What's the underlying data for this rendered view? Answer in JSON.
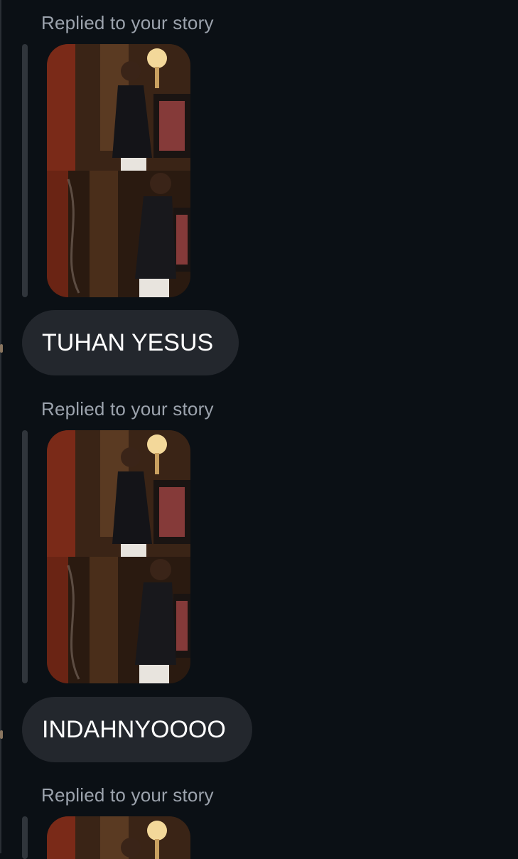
{
  "messages": [
    {
      "type": "story_reply",
      "label": "Replied to your story",
      "thumbnail": "story-photo-collage"
    },
    {
      "type": "text",
      "text": "TUHAN YESUS"
    },
    {
      "type": "story_reply",
      "label": "Replied to your story",
      "thumbnail": "story-photo-collage"
    },
    {
      "type": "text",
      "text": "INDAHNYOOOO"
    },
    {
      "type": "story_reply",
      "label": "Replied to your story",
      "thumbnail": "story-photo-collage"
    }
  ],
  "colors": {
    "background": "#0b1015",
    "bubble": "#23272d",
    "reply_bar": "#30353b",
    "label_text": "#9ca3ad",
    "message_text": "#ffffff"
  }
}
